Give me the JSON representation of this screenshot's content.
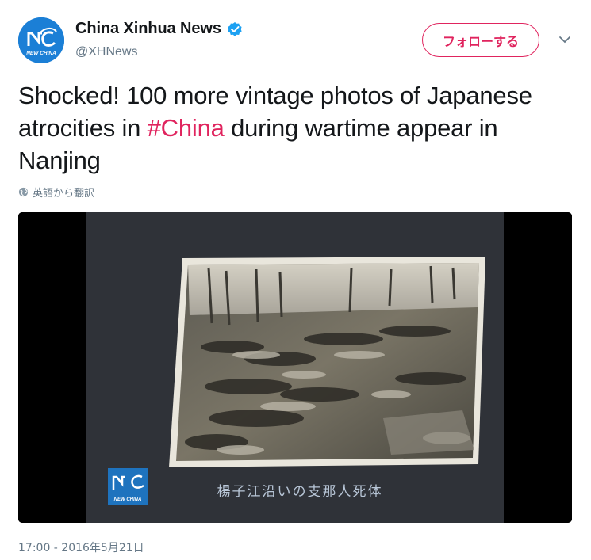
{
  "author": {
    "display_name": "China Xinhua News",
    "handle": "@XHNews",
    "avatar_text": "NEW CHINA",
    "verified": true
  },
  "follow_button": {
    "label": "フォローする"
  },
  "tweet": {
    "text_before": "Shocked! 100 more vintage photos of Japanese atrocities in ",
    "hashtag": "#China",
    "text_after": " during wartime appear in Nanjing"
  },
  "translate": {
    "label": "英語から翻訳"
  },
  "media": {
    "watermark_text": "NEW CHINA",
    "caption": "楊子江沿いの支那人死体"
  },
  "timestamp": "17:00 - 2016年5月21日",
  "colors": {
    "accent": "#e0245e",
    "verified": "#1da1f2",
    "secondary_text": "#657786",
    "brand_blue": "#1b7fd6"
  }
}
